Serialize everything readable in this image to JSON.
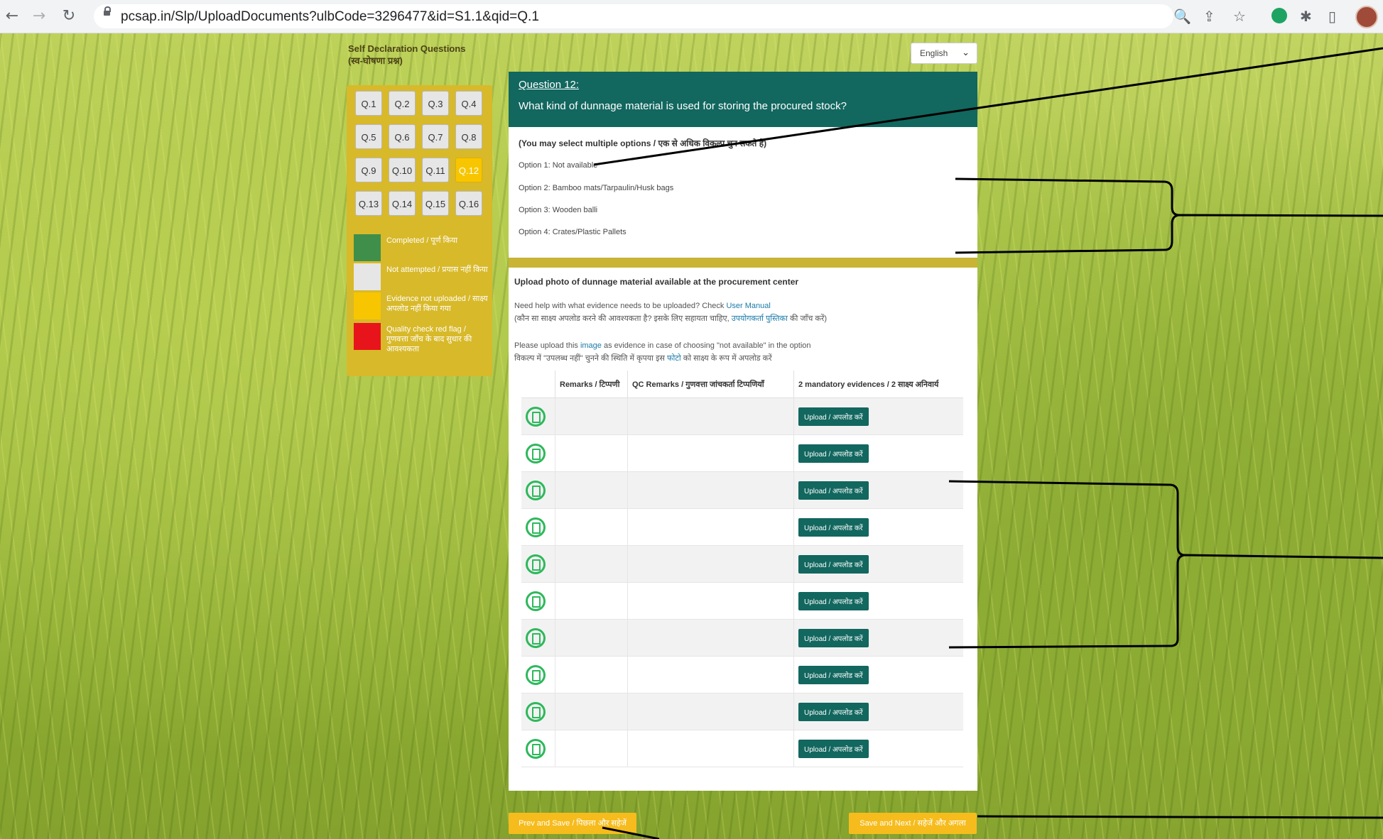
{
  "browser": {
    "url": "pcsap.in/Slp/UploadDocuments?ulbCode=3296477&id=S1.1&qid=Q.1",
    "icons": [
      "back-icon",
      "forward-icon",
      "reload-icon",
      "lock-icon",
      "zoom-icon",
      "share-icon",
      "star-icon",
      "grammarly-icon",
      "extensions-icon",
      "sidepanel-icon",
      "profile-avatar"
    ]
  },
  "sidebar": {
    "title": "Self Declaration Questions",
    "title_hindi": "(स्व-घोषणा प्रश्न)",
    "questions": [
      "Q.1",
      "Q.2",
      "Q.3",
      "Q.4",
      "Q.5",
      "Q.6",
      "Q.7",
      "Q.8",
      "Q.9",
      "Q.10",
      "Q.11",
      "Q.12",
      "Q.13",
      "Q.14",
      "Q.15",
      "Q.16"
    ],
    "active_question": "Q.12",
    "legend": [
      {
        "label": "Completed / पूर्ण किया",
        "color": "#3f8f4a"
      },
      {
        "label": "Not attempted / प्रयास नहीं किया",
        "color": "#e6e6e6"
      },
      {
        "label": "Evidence not uploaded / साक्ष्य अपलोड नहीं किया गया",
        "color": "#f7c600"
      },
      {
        "label": "Quality check red flag / गुणवत्ता जाँच के बाद सुधार की आवश्यकता",
        "color": "#e8141b"
      }
    ]
  },
  "language": {
    "selected": "English"
  },
  "question": {
    "number": "Question 12:",
    "text": "What kind of dunnage material is used for storing the procured stock?",
    "hint": "(You may select multiple options / एक से अधिक विकल्प चुन सकते है)",
    "options": [
      "Option 1: Not available",
      "Option 2: Bamboo mats/Tarpaulin/Husk bags",
      "Option 3: Wooden balli",
      "Option 4: Crates/Plastic Pallets"
    ]
  },
  "upload": {
    "title": "Upload photo of dunnage material available at the procurement center",
    "help_line1_prefix": "Need help with what evidence needs to be uploaded? Check ",
    "help_line1_link": "User Manual",
    "help_line2_prefix": "(कौन सा साक्ष्य अपलोड करने की आवश्यकता है? इसके लिए सहायता चाहिए, ",
    "help_line2_link": "उपयोगकर्ता पुस्तिका",
    "help_line2_suffix": " की जाँच करें)",
    "note_line1_prefix": "Please upload this ",
    "note_line1_link": "image",
    "note_line1_suffix": " as evidence in case of choosing \"not available\" in the option",
    "note_line2_prefix": "विकल्प में \"उपलब्ध नहीं\" चुनने की स्थिति में कृपया इस ",
    "note_line2_link": "फोटो",
    "note_line2_suffix": " को साक्ष्य के रूप में अपलोड करें",
    "table_headers": [
      "",
      "Remarks / टिप्पणी",
      "QC Remarks / गुणवत्ता जांचकर्ता टिप्पणियाँ",
      "2 mandatory evidences / 2 साक्ष्य अनिवार्य"
    ],
    "upload_label": "Upload / अपलोड करें",
    "row_count": 10
  },
  "footer": {
    "prev_save": "Prev and Save / पिछला और सहेजें",
    "save_next": "Save and Next / सहेजें और अगला"
  },
  "colors": {
    "teal": "#12675f",
    "yellow": "#f6bc1d",
    "green_icon": "#2eb85c"
  }
}
